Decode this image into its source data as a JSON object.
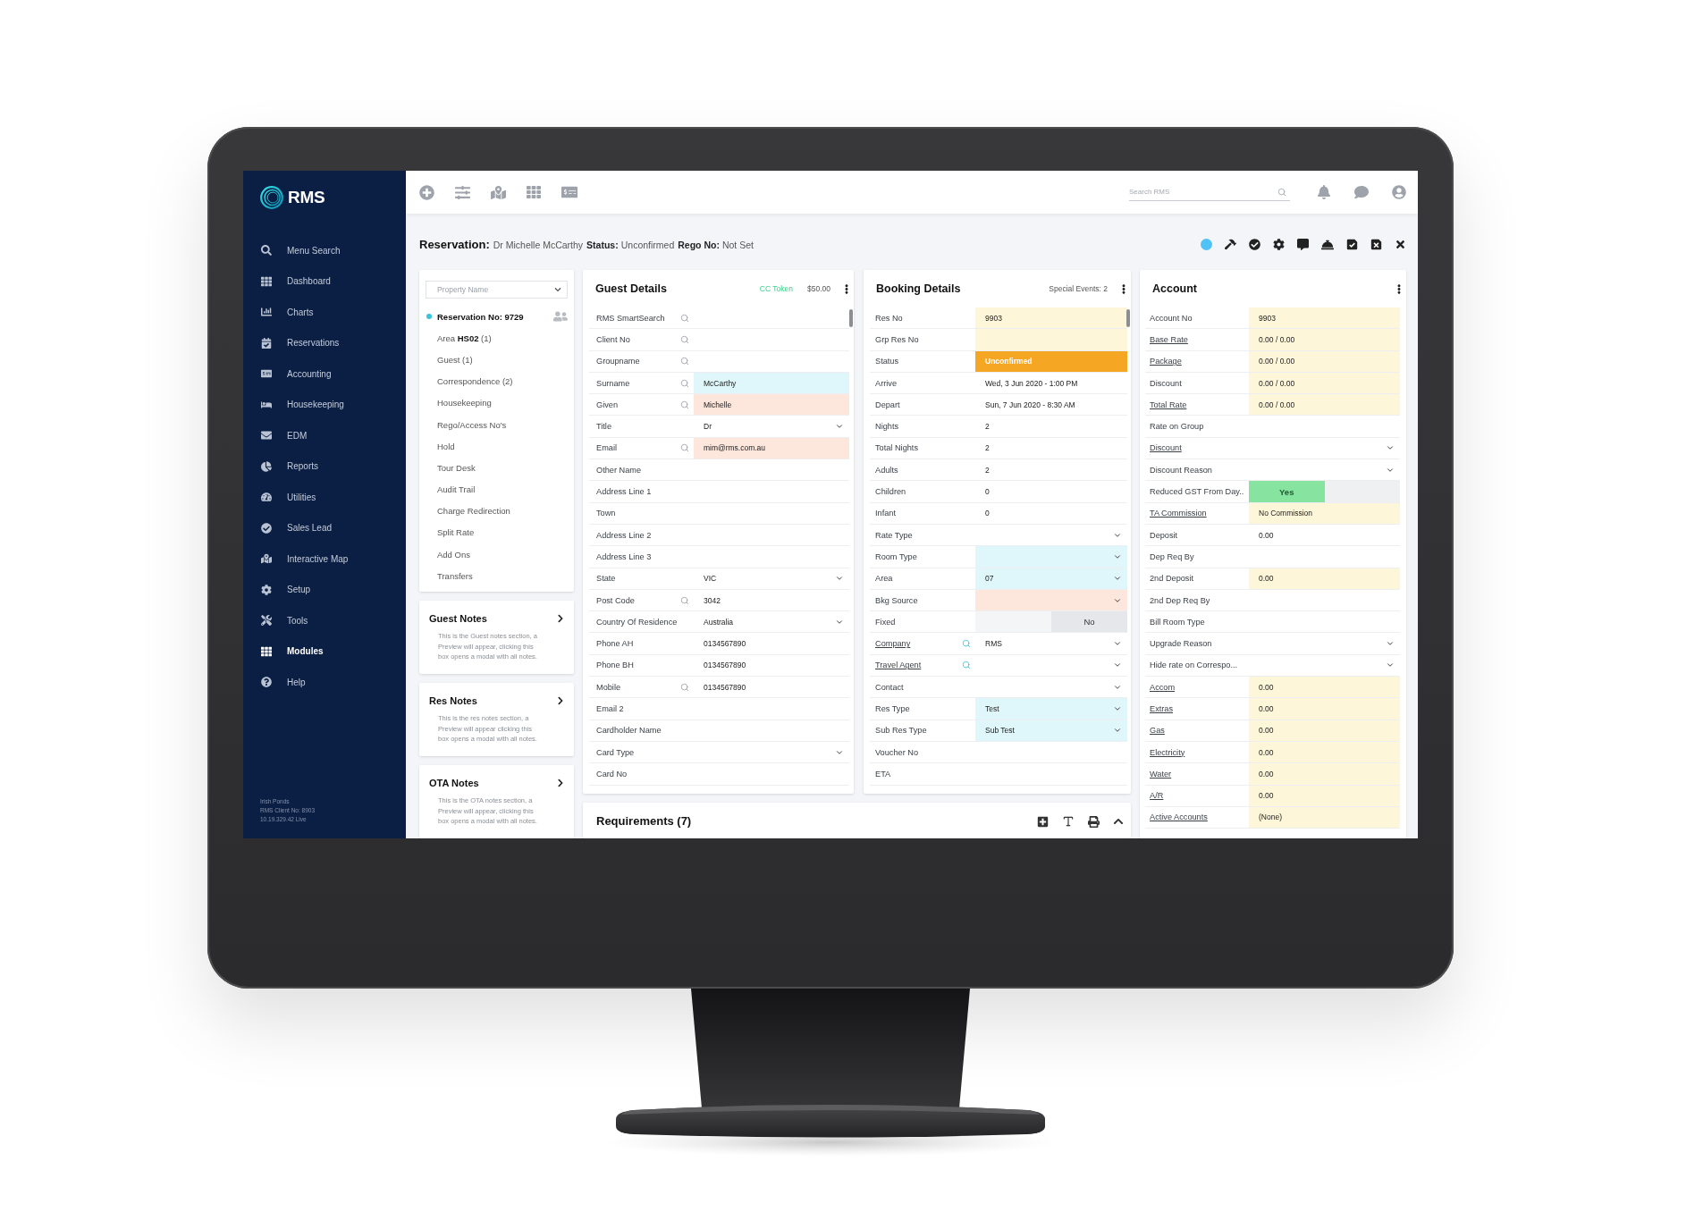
{
  "sidebar": {
    "logo": "RMS",
    "items": [
      {
        "label": "Menu Search",
        "selected": false
      },
      {
        "label": "Dashboard",
        "selected": false
      },
      {
        "label": "Charts",
        "selected": false
      },
      {
        "label": "Reservations",
        "selected": false
      },
      {
        "label": "Accounting",
        "selected": false
      },
      {
        "label": "Housekeeping",
        "selected": false
      },
      {
        "label": "EDM",
        "selected": false
      },
      {
        "label": "Reports",
        "selected": false
      },
      {
        "label": "Utilities",
        "selected": false
      },
      {
        "label": "Sales Lead",
        "selected": false
      },
      {
        "label": "Interactive Map",
        "selected": false
      },
      {
        "label": "Setup",
        "selected": false
      },
      {
        "label": "Tools",
        "selected": false
      },
      {
        "label": "Modules",
        "selected": true
      },
      {
        "label": "Help",
        "selected": false
      }
    ],
    "footer": [
      "Irish Ponds",
      "RMS Client No: 8903",
      "10.19.329.42 Live"
    ]
  },
  "topbar": {
    "search": {
      "placeholder": "Search RMS"
    }
  },
  "reservation": {
    "title": "Reservation:",
    "guest": "Dr Michelle McCarthy",
    "facts": [
      {
        "label": "Status:",
        "value": "Unconfirmed"
      },
      {
        "label": "Rego No:",
        "value": "Not Set"
      }
    ]
  },
  "navigator": {
    "property_select": {
      "placeholder": "Property Name"
    },
    "items": [
      {
        "label": "Reservation No: 9729",
        "selected": true
      },
      {
        "label": "Area **HS02** (1)",
        "selected": false
      },
      {
        "label": "Guest (1)",
        "selected": false
      },
      {
        "label": "Correspondence (2)",
        "selected": false
      },
      {
        "label": "Housekeeping",
        "selected": false
      },
      {
        "label": "Rego/Access No's",
        "selected": false
      },
      {
        "label": "Hold",
        "selected": false
      },
      {
        "label": "Tour Desk",
        "selected": false
      },
      {
        "label": "Audit Trail",
        "selected": false
      },
      {
        "label": "Charge Redirection",
        "selected": false
      },
      {
        "label": "Split Rate",
        "selected": false
      },
      {
        "label": "Add Ons",
        "selected": false
      },
      {
        "label": "Transfers",
        "selected": false
      }
    ]
  },
  "notes": [
    {
      "title": "Guest Notes",
      "text": "This is the Guest notes section, a Preview will appear, clicking this box opens a modal with all notes."
    },
    {
      "title": "Res Notes",
      "text": "This is the res notes section, a Preview will appear clicking this box opens a modal with all notes."
    },
    {
      "title": "OTA Notes",
      "text": "This is the OTA notes section, a Preview will appear, clicking this box opens a modal with all notes."
    }
  ],
  "guest_details": {
    "title": "Guest Details",
    "token": "CC Token",
    "amount": "$50.00",
    "rows": [
      {
        "label": "RMS SmartSearch",
        "kind": "text",
        "lookup": true
      },
      {
        "label": "Client No",
        "kind": "text",
        "lookup": true
      },
      {
        "label": "Groupname",
        "kind": "text",
        "lookup": true
      },
      {
        "label": "Surname",
        "kind": "text",
        "lookup": true,
        "value": "McCarthy",
        "color": "#dff7fa"
      },
      {
        "label": "Given",
        "kind": "text",
        "lookup": true,
        "value": "Michelle",
        "color": "#fde6dc"
      },
      {
        "label": "Title",
        "kind": "select",
        "value": "Dr"
      },
      {
        "label": "Email",
        "kind": "text",
        "lookup": true,
        "value": "mim@rms.com.au",
        "color": "#fde6dc"
      },
      {
        "label": "Other Name",
        "kind": "text"
      },
      {
        "label": "Address Line 1",
        "kind": "text"
      },
      {
        "label": "Town",
        "kind": "text"
      },
      {
        "label": "Address Line 2",
        "kind": "text"
      },
      {
        "label": "Address Line 3",
        "kind": "text"
      },
      {
        "label": "State",
        "kind": "select",
        "value": "VIC"
      },
      {
        "label": "Post Code",
        "kind": "text",
        "lookup": true,
        "value": "3042"
      },
      {
        "label": "Country Of Residence",
        "kind": "select",
        "value": "Australia"
      },
      {
        "label": "Phone AH",
        "kind": "text",
        "value": "0134567890"
      },
      {
        "label": "Phone BH",
        "kind": "text",
        "value": "0134567890"
      },
      {
        "label": "Mobile",
        "kind": "text",
        "lookup": true,
        "value": "0134567890"
      },
      {
        "label": "Email 2",
        "kind": "text"
      },
      {
        "label": "Cardholder Name",
        "kind": "text"
      },
      {
        "label": "Card Type",
        "kind": "select"
      },
      {
        "label": "Card No",
        "kind": "text"
      }
    ]
  },
  "booking_details": {
    "title": "Booking Details",
    "special_events": "Special Events: 2",
    "rows": [
      {
        "label": "Res No",
        "kind": "text",
        "value": "9903",
        "color": "#fdf6d8"
      },
      {
        "label": "Grp Res No",
        "kind": "text",
        "color": "#fdf6d8"
      },
      {
        "label": "Status",
        "kind": "text",
        "value": "Unconfirmed",
        "color": "#f5a623"
      },
      {
        "label": "Arrive",
        "kind": "text",
        "value": "Wed, 3 Jun 2020 - 1:00 PM"
      },
      {
        "label": "Depart",
        "kind": "text",
        "value": "Sun, 7 Jun 2020 - 8:30 AM"
      },
      {
        "label": "Nights",
        "kind": "text",
        "value": "2"
      },
      {
        "label": "Total Nights",
        "kind": "text",
        "value": "2"
      },
      {
        "label": "Adults",
        "kind": "text",
        "value": "2"
      },
      {
        "label": "Children",
        "kind": "text",
        "value": "0"
      },
      {
        "label": "Infant",
        "kind": "text",
        "value": "0"
      },
      {
        "label": "Rate Type",
        "kind": "select"
      },
      {
        "label": "Room Type",
        "kind": "select",
        "color": "#dff7fa"
      },
      {
        "label": "Area",
        "kind": "select",
        "value": "07",
        "color": "#dff7fa"
      },
      {
        "label": "Bkg Source",
        "kind": "select",
        "color": "#fde6dc"
      },
      {
        "label": "Fixed",
        "kind": "toggle",
        "value": "No",
        "on": false
      },
      {
        "label": "Company",
        "kind": "select",
        "link": true,
        "lookup": true,
        "value": "RMS"
      },
      {
        "label": "Travel Agent",
        "kind": "select",
        "link": true,
        "lookup": true
      },
      {
        "label": "Contact",
        "kind": "select"
      },
      {
        "label": "Res Type",
        "kind": "select",
        "value": "Test",
        "color": "#dff7fa"
      },
      {
        "label": "Sub Res Type",
        "kind": "select",
        "value": "Sub Test",
        "color": "#dff7fa"
      },
      {
        "label": "Voucher No",
        "kind": "text"
      },
      {
        "label": "ETA",
        "kind": "text"
      }
    ]
  },
  "account": {
    "title": "Account",
    "rows": [
      {
        "label": "Account No",
        "kind": "text",
        "value": "9903",
        "color": "#fdf6d8"
      },
      {
        "label": "Base Rate",
        "kind": "text",
        "link": true,
        "value": "0.00 / 0.00",
        "color": "#fdf6d8"
      },
      {
        "label": "Package",
        "kind": "text",
        "link": true,
        "value": "0.00 / 0.00",
        "color": "#fdf6d8"
      },
      {
        "label": "Discount",
        "kind": "text",
        "value": "0.00 / 0.00",
        "color": "#fdf6d8"
      },
      {
        "label": "Total Rate",
        "kind": "text",
        "link": true,
        "value": "0.00 / 0.00",
        "color": "#fdf6d8"
      },
      {
        "label": "Rate on Group",
        "kind": "text"
      },
      {
        "label": "Discount",
        "kind": "select",
        "link": true
      },
      {
        "label": "Discount Reason",
        "kind": "select"
      },
      {
        "label": "Reduced GST From Day..",
        "kind": "toggle",
        "value": "Yes",
        "on": true
      },
      {
        "label": "TA Commission",
        "kind": "text",
        "link": true,
        "value": "No Commission",
        "color": "#fdf6d8"
      },
      {
        "label": "Deposit",
        "kind": "text",
        "value": "0.00"
      },
      {
        "label": "Dep Req By",
        "kind": "text"
      },
      {
        "label": "2nd Deposit",
        "kind": "text",
        "value": "0.00",
        "color": "#fdf6d8"
      },
      {
        "label": "2nd Dep Req By",
        "kind": "text"
      },
      {
        "label": "Bill Room Type",
        "kind": "text"
      },
      {
        "label": "Upgrade Reason",
        "kind": "select"
      },
      {
        "label": "Hide rate on Correspo...",
        "kind": "select"
      },
      {
        "label": "Accom",
        "kind": "text",
        "link": true,
        "value": "0.00",
        "color": "#fdf6d8"
      },
      {
        "label": "Extras",
        "kind": "text",
        "link": true,
        "value": "0.00",
        "color": "#fdf6d8"
      },
      {
        "label": "Gas",
        "kind": "text",
        "link": true,
        "value": "0.00",
        "color": "#fdf6d8"
      },
      {
        "label": "Electricity",
        "kind": "text",
        "link": true,
        "value": "0.00",
        "color": "#fdf6d8"
      },
      {
        "label": "Water",
        "kind": "text",
        "link": true,
        "value": "0.00",
        "color": "#fdf6d8"
      },
      {
        "label": "A/R",
        "kind": "text",
        "link": true,
        "value": "0.00",
        "color": "#fdf6d8"
      },
      {
        "label": "Active Accounts",
        "kind": "text",
        "link": true,
        "value": "(None)",
        "color": "#fdf6d8"
      }
    ]
  },
  "requirements": {
    "title": "Requirements (7)"
  }
}
